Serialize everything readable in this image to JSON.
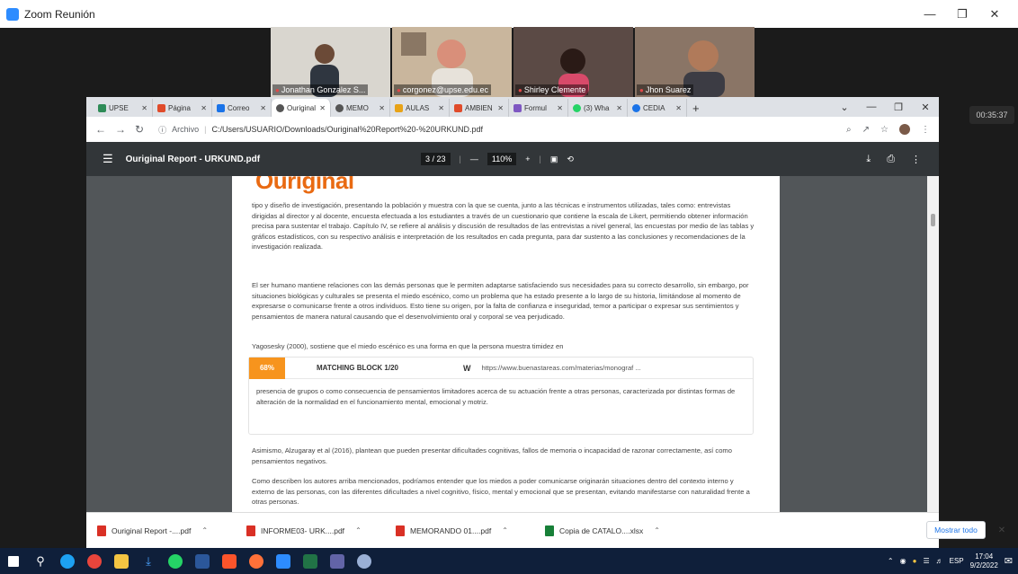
{
  "zoom": {
    "window_title": "Zoom Reunión",
    "timer": "00:35:37",
    "participants": [
      {
        "name": "Jonathan Gonzalez S...",
        "bg": "#d9d6cf"
      },
      {
        "name": "corgonez@upse.edu.ec",
        "bg": "#b9a089"
      },
      {
        "name": "Shirley Clemente",
        "bg": "#4a3a36"
      },
      {
        "name": "Jhon Suarez",
        "bg": "#7b6455"
      }
    ]
  },
  "chrome": {
    "tabs": [
      {
        "label": "UPSE",
        "color": "#2e8b57"
      },
      {
        "label": "Página",
        "color": "#e04b2b"
      },
      {
        "label": "Correo",
        "color": "#1a73e8"
      },
      {
        "label": "Ouriginal",
        "color": "#555555",
        "active": true
      },
      {
        "label": "MEMO",
        "color": "#555555"
      },
      {
        "label": "AULAS",
        "color": "#e8a317"
      },
      {
        "label": "AMBIEN",
        "color": "#e04b2b"
      },
      {
        "label": "Formul",
        "color": "#7e57c2"
      },
      {
        "label": "(3) Wha",
        "color": "#25d366"
      },
      {
        "label": "CEDIA",
        "color": "#1a73e8"
      }
    ],
    "new_tab": "+",
    "url_protocol": "Archivo",
    "url": "C:/Users/USUARIO/Downloads/Ouriginal%20Report%20-%20URKUND.pdf"
  },
  "pdf": {
    "title": "Ouriginal Report - URKUND.pdf",
    "page_current": "3",
    "page_total": "23",
    "zoom": "110%",
    "logo": "Ouriginal",
    "paragraphs": [
      "tipo y diseño de investigación, presentando la población y muestra con la que se cuenta, junto a las técnicas e instrumentos utilizadas, tales como: entrevistas dirigidas al director y al docente, encuesta efectuada a los estudiantes a través de un cuestionario que contiene la escala de Likert, permitiendo obtener información precisa para sustentar el trabajo. Capítulo IV, se refiere al análisis y discusión de resultados de las entrevistas a nivel general, las encuestas por medio de las tablas y gráficos estadísticos, con su respectivo análisis e interpretación de los resultados en cada pregunta, para dar sustento a las conclusiones y recomendaciones de la investigación realizada.",
      "El ser humano mantiene relaciones con las demás personas que le permiten adaptarse satisfaciendo sus necesidades para su correcto desarrollo, sin embargo, por situaciones biológicas y culturales se presenta el miedo escénico, como un problema que ha estado presente a lo largo de su historia, limitándose al momento de expresarse o comunicarse frente a otros individuos. Esto tiene su origen, por la falta de confianza e inseguridad, temor a participar o expresar sus sentimientos y pensamientos de manera natural causando que el desenvolvimiento oral y corporal se vea perjudicado.",
      "Yagosesky (2000), sostiene que el miedo escénico es una forma en que la persona muestra timidez en"
    ],
    "match": {
      "percent": "68%",
      "title": "MATCHING BLOCK 1/20",
      "source_icon": "W",
      "url": "https://www.buenastareas.com/materias/monograf ...",
      "text": "presencia de grupos o como consecuencia de pensamientos limitadores acerca de su actuación frente a otras personas, caracterizada por distintas formas de alteración de la normalidad en el funcionamiento mental, emocional y motriz."
    },
    "paragraphs_after": [
      "Asimismo, Alzugaray et al (2016), plantean que pueden presentar dificultades cognitivas, fallos de memoria o incapacidad de razonar correctamente, así como pensamientos negativos.",
      "Como describen los autores arriba mencionados, podríamos entender que los miedos a poder comunicarse originarán situaciones dentro del contexto interno y externo de las personas, con las diferentes dificultades a nivel cognitivo, físico, mental y emocional que se presentan, evitando manifestarse con naturalidad frente a otras personas."
    ]
  },
  "downloads": {
    "items": [
      {
        "label": "Ouriginal Report -....pdf",
        "color": "#d93025"
      },
      {
        "label": "INFORME03- URK....pdf",
        "color": "#d93025"
      },
      {
        "label": "MEMORANDO 01....pdf",
        "color": "#d93025"
      },
      {
        "label": "Copia de CATALO....xlsx",
        "color": "#188038"
      }
    ],
    "show_all": "Mostrar todo"
  },
  "taskbar": {
    "icons": [
      {
        "name": "start-icon",
        "color": "#ffffff"
      },
      {
        "name": "search-icon",
        "color": "#ffffff"
      },
      {
        "name": "edge-icon",
        "color": "#1da1f2"
      },
      {
        "name": "chrome-icon",
        "color": "#e8453c"
      },
      {
        "name": "file-explorer-icon",
        "color": "#f4c542"
      },
      {
        "name": "download-icon",
        "color": "#4aa3ff"
      },
      {
        "name": "whatsapp-icon",
        "color": "#25d366"
      },
      {
        "name": "word-icon",
        "color": "#2b579a"
      },
      {
        "name": "brave-icon",
        "color": "#fb542b"
      },
      {
        "name": "firefox-icon",
        "color": "#ff7139"
      },
      {
        "name": "zoom-icon",
        "color": "#2d8cff"
      },
      {
        "name": "excel-icon",
        "color": "#217346"
      },
      {
        "name": "teams-icon",
        "color": "#6264a7"
      },
      {
        "name": "paint-icon",
        "color": "#9ab0d6"
      }
    ],
    "language": "ESP",
    "time": "17:04",
    "date": "9/2/2022"
  }
}
